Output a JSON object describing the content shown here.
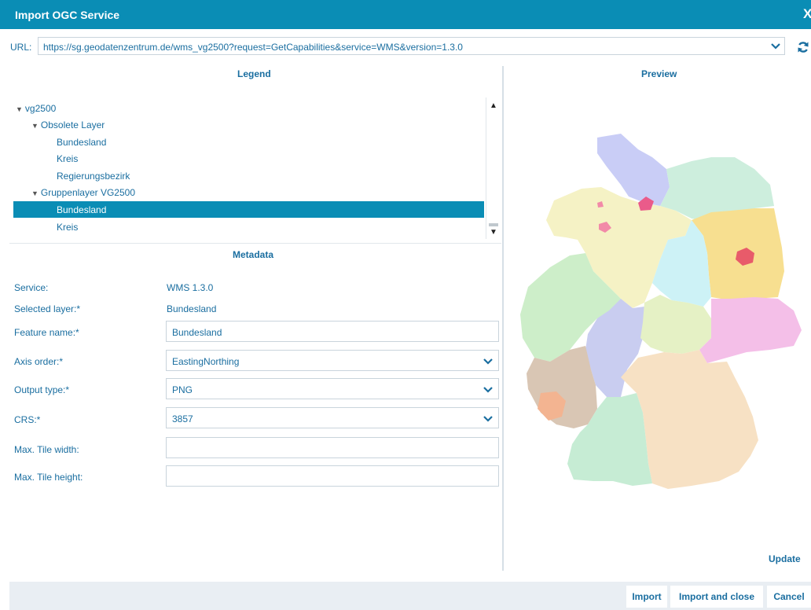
{
  "window": {
    "title": "Import OGC Service",
    "close_glyph": "X"
  },
  "url": {
    "label": "URL:",
    "value": "https://sg.geodatenzentrum.de/wms_vg2500?request=GetCapabilities&service=WMS&version=1.3.0",
    "icons": [
      "chevron-down-icon",
      "refresh-icon"
    ]
  },
  "legend": {
    "header": "Legend",
    "tree": [
      {
        "label": "vg2500",
        "expanded": true
      },
      {
        "label": "Obsolete Layer",
        "expanded": true
      },
      {
        "label": "Bundesland"
      },
      {
        "label": "Kreis"
      },
      {
        "label": "Regierungsbezirk"
      },
      {
        "label": "Gruppenlayer VG2500",
        "expanded": true
      },
      {
        "label": "Bundesland",
        "selected": true
      },
      {
        "label": "Kreis"
      }
    ]
  },
  "preview": {
    "header": "Preview",
    "update_label": "Update"
  },
  "metadata": {
    "header": "Metadata",
    "service_label": "Service:",
    "service_value": "WMS 1.3.0",
    "selected_layer_label": "Selected layer:*",
    "selected_layer_value": "Bundesland",
    "feature_name_label": "Feature name:*",
    "feature_name_value": "Bundesland",
    "axis_order_label": "Axis order:*",
    "axis_order_value": "EastingNorthing",
    "output_type_label": "Output type:*",
    "output_type_value": "PNG",
    "crs_label": "CRS:*",
    "crs_value": "3857",
    "max_tile_width_label": "Max. Tile width:",
    "max_tile_width_value": "",
    "max_tile_height_label": "Max. Tile height:",
    "max_tile_height_value": ""
  },
  "buttons": {
    "import": "Import",
    "import_close": "Import and close",
    "cancel": "Cancel"
  },
  "colors": {
    "accent": "#0a8db5",
    "text": "#1a6ea0",
    "footer": "#e9eef3"
  }
}
